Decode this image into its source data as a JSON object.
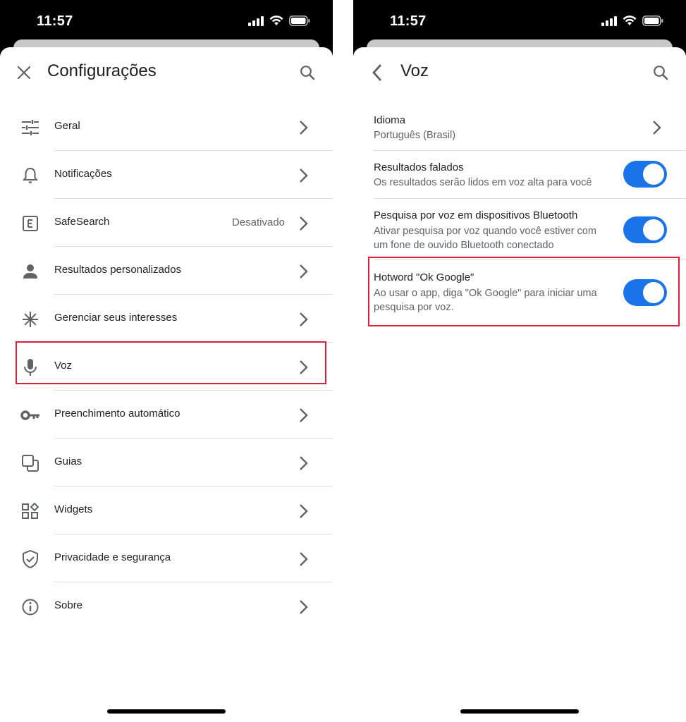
{
  "left_screen": {
    "status": {
      "time": "11:57"
    },
    "header": {
      "title": "Configurações"
    },
    "items": [
      {
        "label": "Geral",
        "value": ""
      },
      {
        "label": "Notificações",
        "value": ""
      },
      {
        "label": "SafeSearch",
        "value": "Desativado"
      },
      {
        "label": "Resultados personalizados",
        "value": ""
      },
      {
        "label": "Gerenciar seus interesses",
        "value": ""
      },
      {
        "label": "Voz",
        "value": ""
      },
      {
        "label": "Preenchimento automático",
        "value": ""
      },
      {
        "label": "Guias",
        "value": ""
      },
      {
        "label": "Widgets",
        "value": ""
      },
      {
        "label": "Privacidade e segurança",
        "value": ""
      },
      {
        "label": "Sobre",
        "value": ""
      }
    ]
  },
  "right_screen": {
    "status": {
      "time": "11:57"
    },
    "header": {
      "title": "Voz"
    },
    "items": [
      {
        "title": "Idioma",
        "subtitle": "Português (Brasil)"
      },
      {
        "title": "Resultados falados",
        "subtitle": "Os resultados serão lidos em voz alta para você",
        "toggle_on": true
      },
      {
        "title": "Pesquisa por voz em dispositivos Bluetooth",
        "subtitle": "Ativar pesquisa por voz quando você estiver com um fone de ouvido Bluetooth conectado",
        "toggle_on": true
      },
      {
        "title": "Hotword \"Ok Google\"",
        "subtitle": "Ao usar o app, diga \"Ok Google\" para iniciar uma pesquisa por voz.",
        "toggle_on": true
      }
    ]
  },
  "colors": {
    "accent": "#1a73e8",
    "highlight": "#d9213b"
  }
}
